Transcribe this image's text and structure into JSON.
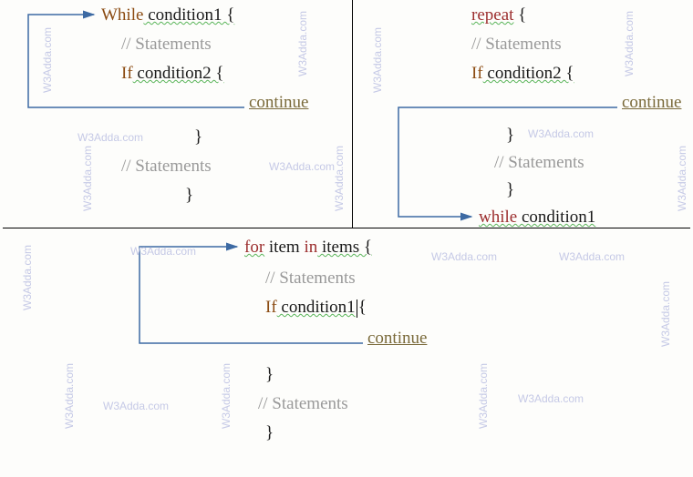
{
  "watermark": "W3Adda.com",
  "while_panel": {
    "l1_kw": "While",
    "l1_rest": " condition1 {",
    "l2": "// Statements",
    "l3_kw": "If",
    "l3_rest": " condition2 {",
    "l4": "continue",
    "l5": "}",
    "l6": "// Statements",
    "l7": "}"
  },
  "repeat_panel": {
    "l1_kw": "repeat",
    "l1_rest": " {",
    "l2": "// Statements",
    "l3_kw": "If",
    "l3_rest": " condition2 {",
    "l4": "continue",
    "l5": "}",
    "l6": "// Statements",
    "l7": "}",
    "l8_kw": "while",
    "l8_rest": " condition1"
  },
  "for_panel": {
    "l1_kw1": "for",
    "l1_mid": " item ",
    "l1_kw2": "in",
    "l1_rest": " items {",
    "l2": "// Statements",
    "l3_kw": "If",
    "l3_rest": " condition1",
    "l3_brace": "{",
    "l4": "continue",
    "l5": "}",
    "l6": "// Statements",
    "l7": "}"
  }
}
